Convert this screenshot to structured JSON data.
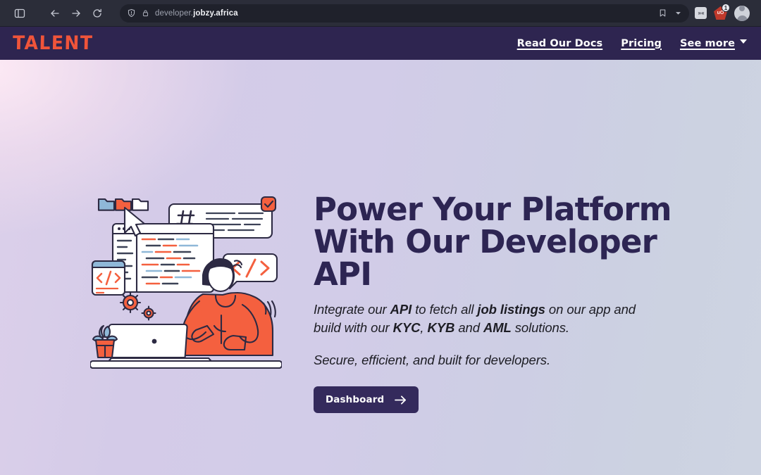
{
  "browser": {
    "sidebar_toggle_icon": "sidebar-toggle-icon",
    "back_icon": "back-arrow-icon",
    "forward_icon": "forward-arrow-icon",
    "reload_icon": "reload-icon",
    "shield_icon": "shield-icon",
    "lock_icon": "lock-icon",
    "bookmark_icon": "bookmark-icon",
    "overflow_icon": "chevron-down-icon",
    "url_prefix": "developer.",
    "url_domain": "jobzy.africa",
    "extensions": [
      {
        "name": "puzzle-extension-icon",
        "glyph": "» «"
      },
      {
        "name": "ublock-origin-icon",
        "glyph": "uO",
        "badge": "1"
      }
    ],
    "profile_avatar": "account-avatar"
  },
  "site": {
    "logo": "TALENT",
    "nav": [
      {
        "label": "Read Our Docs",
        "name": "nav-read-our-docs"
      },
      {
        "label": "Pricing",
        "name": "nav-pricing"
      },
      {
        "label": "See more",
        "name": "nav-see-more",
        "has_caret": true
      }
    ]
  },
  "hero": {
    "headline_line1": "Power Your Platform",
    "headline_line2": "With Our Developer API",
    "sub_parts": [
      {
        "text": "Integrate our ",
        "bold": false
      },
      {
        "text": "API",
        "bold": true
      },
      {
        "text": " to fetch all ",
        "bold": false
      },
      {
        "text": "job listings",
        "bold": true
      },
      {
        "text": " on our app and build with our ",
        "bold": false
      },
      {
        "text": "KYC",
        "bold": true
      },
      {
        "text": ", ",
        "bold": false
      },
      {
        "text": "KYB",
        "bold": true
      },
      {
        "text": " and ",
        "bold": false
      },
      {
        "text": "AML",
        "bold": true
      },
      {
        "text": " solutions.",
        "bold": false
      }
    ],
    "sub_plain": "Integrate our API to fetch all job listings on our app and build with our KYC, KYB and AML solutions.",
    "tagline": "Secure, efficient, and built for developers.",
    "cta_label": "Dashboard",
    "cta_arrow_icon": "arrow-right-icon",
    "illustration_name": "developer-coding-illustration"
  },
  "colors": {
    "brand_orange": "#f0543a",
    "header_purple": "#2e2550",
    "headline_purple": "#2d2553",
    "button_purple": "#342a5c",
    "bg_left": "#dcd0ea",
    "bg_right": "#ced4e2",
    "chrome_bg": "#2b2d39",
    "urlbar_bg": "#1f212b"
  }
}
